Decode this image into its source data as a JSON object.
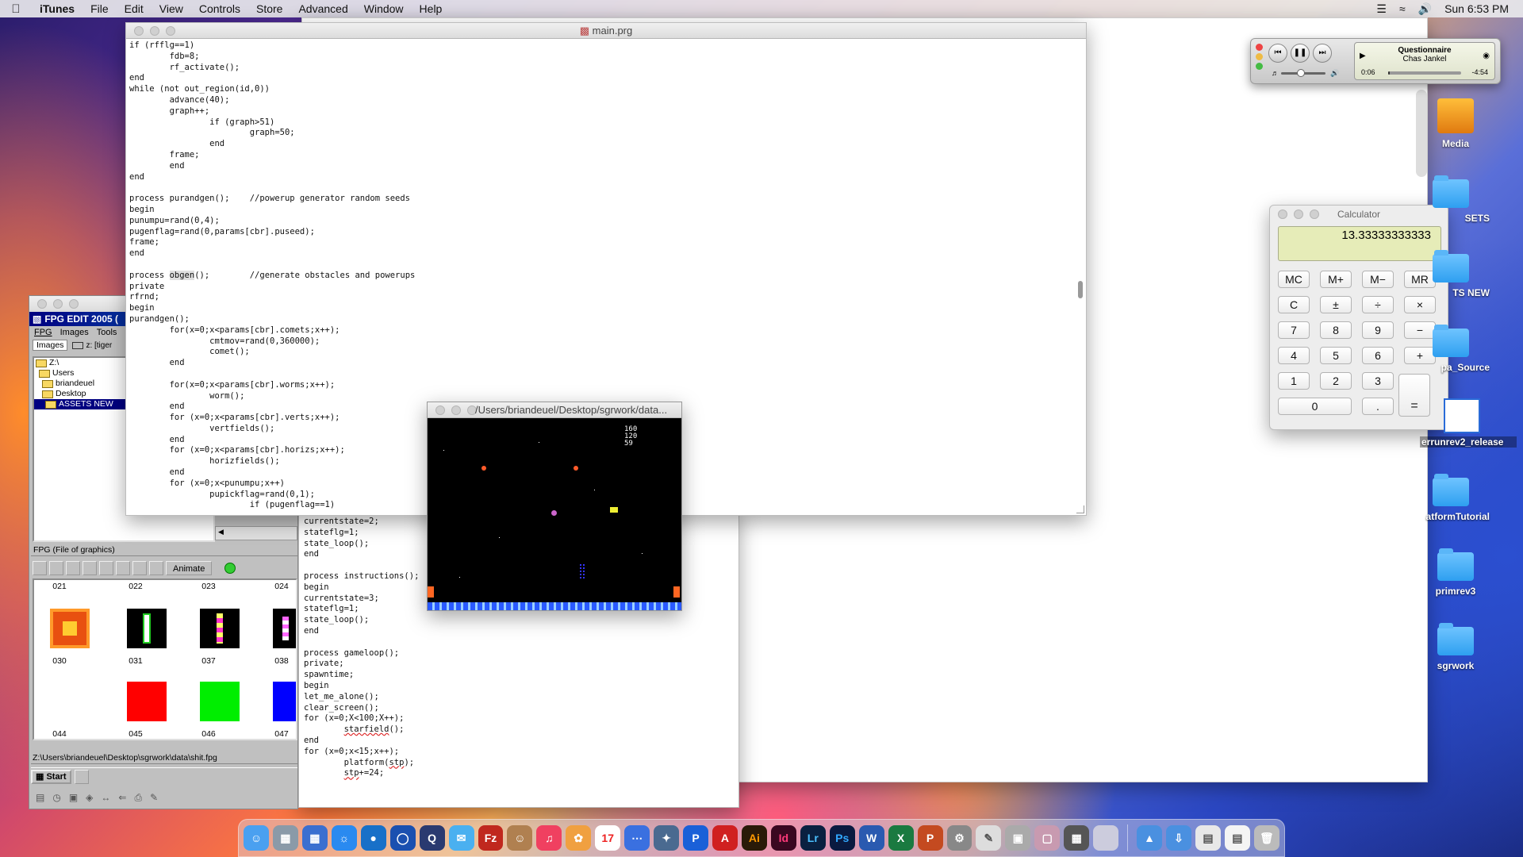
{
  "menubar": {
    "app_name": "iTunes",
    "items": [
      "File",
      "Edit",
      "View",
      "Controls",
      "Store",
      "Advanced",
      "Window",
      "Help"
    ],
    "clock": "Sun 6:53 PM"
  },
  "editor": {
    "title": "main.prg",
    "code_top": "if (rfflg==1)\n        fdb=8;\n        rf_activate();\nend\nwhile (not out_region(id,0))\n        advance(40);\n        graph++;\n                if (graph>51)\n                        graph=50;\n                end\n        frame;\n        end\nend\n\nprocess purandgen();    //powerup generator random seeds\nbegin\npunumpu=rand(0,4);\npugenflag=rand(0,params[cbr].puseed);\nframe;\nend\n\nprocess ",
    "code_hl": "obgen",
    "code_after_hl": "();        //generate obstacles and powerups\nprivate\nrfrnd;\nbegin\npurandgen();\n        for(x=0;x<params[cbr].comets;x++);\n                cmtmov=rand(0,360000);\n                comet();\n        end\n\n        for(x=0;x<params[cbr].worms;x++);\n                worm();\n        end\n        for (x=0;x<params[cbr].verts;x++);\n                vertfields();\n        end\n        for (x=0;x<params[cbr].horizs;x++);\n                horizfields();\n        end\n        for (x=0;x<punumpu;x++)\n                pupickflag=rand(0,1);\n                        if (pugenflag==1)",
    "code_bottom_a": "currentstate=2;\nstateflg=1;\nstate_loop();\nend\n\nprocess instructions();\nbegin\ncurrentstate=3;\nstateflg=1;\nstate_loop();\nend\n\nprocess gameloop();\nprivate;\nspawntime;\nbegin\nlet_me_alone();\nclear_screen();\nfor (x=0;X<100;X++);\n        ",
    "code_sq1": "starfield",
    "code_bottom_b": "();\nend\nfor (x=0;x<15;x++);\n        platform(",
    "code_sq2": "stp",
    "code_bottom_c": ");\n        ",
    "code_sq3": "stp",
    "code_bottom_d": "+=24;"
  },
  "fpg_edit": {
    "title": "FPG EDIT 2005 (",
    "menu": [
      "FPG",
      "Images",
      "Tools"
    ],
    "tab": "Images",
    "drive": "z: [tiger",
    "tree": [
      "Z:\\",
      "Users",
      "briandeuel",
      "Desktop",
      "ASSETS NEW"
    ],
    "fpg_panel_title": "FPG (File of graphics)",
    "animate_label": "Animate",
    "thumbs_row1": [
      "021",
      "022",
      "023",
      "024"
    ],
    "thumbs_row2": [
      "030",
      "031",
      "037",
      "038"
    ],
    "thumbs_row3": [
      "044",
      "045",
      "046",
      "047"
    ],
    "path": "Z:\\Users\\briandeuel\\Desktop\\sgrwork\\data\\shit.fpg",
    "start_label": "Start"
  },
  "game_window": {
    "title": "/Users/briandeuel/Desktop/sgrwork/data...",
    "hud": [
      "160",
      "120",
      "59"
    ]
  },
  "itunes_mini": {
    "song": "Questionnaire",
    "artist": "Chas Jankel",
    "elapsed": "0:06",
    "remaining": "-4:54",
    "progress": 0.02,
    "volume": 0.35
  },
  "calculator": {
    "title": "Calculator",
    "display": "13.33333333333",
    "buttons": [
      [
        "MC",
        "M+",
        "M−",
        "MR"
      ],
      [
        "C",
        "±",
        "÷",
        "×"
      ],
      [
        "7",
        "8",
        "9",
        "−"
      ],
      [
        "4",
        "5",
        "6",
        "+"
      ],
      [
        "1",
        "2",
        "3"
      ],
      [
        "0",
        "."
      ]
    ],
    "equals": "="
  },
  "desktop_icons": [
    "Media",
    "SETS",
    "TS NEW",
    "pa_Source",
    "errunrev2_release",
    "atformTutorial",
    "primrev3",
    "sgrwork"
  ],
  "colors": {
    "accent": "#000080",
    "calc_display": "#e6ecb8"
  }
}
